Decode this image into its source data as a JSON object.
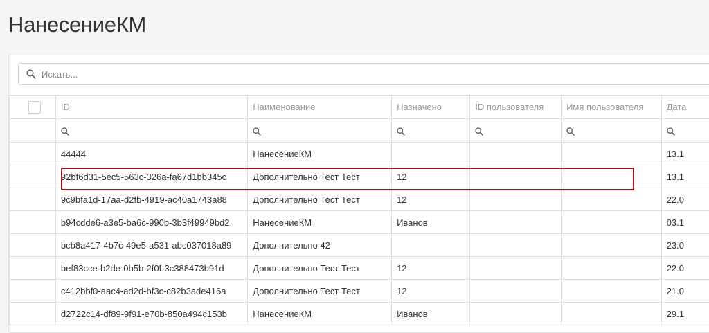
{
  "page_title": "НанесениеКМ",
  "search": {
    "placeholder": "Искать..."
  },
  "columns": [
    "ID",
    "Наименование",
    "Назначено",
    "ID пользователя",
    "Имя пользователя",
    "Дата"
  ],
  "rows": [
    {
      "id": "44444",
      "name": "НанесениеКМ",
      "assigned": "",
      "user_id": "",
      "user_name": "",
      "date": "13.1"
    },
    {
      "id": "92bf6d31-5ec5-563c-326a-fa67d1bb345c",
      "name": "Дополнительно Тест Тест",
      "assigned": "12",
      "user_id": "",
      "user_name": "",
      "date": "13.1"
    },
    {
      "id": "9c9bfa1d-17aa-d2fb-4919-ac40a1743a88",
      "name": "Дополнительно Тест Тест",
      "assigned": "12",
      "user_id": "",
      "user_name": "",
      "date": "22.0"
    },
    {
      "id": "b94cdde6-a3e5-ba6c-990b-3b3f49949bd2",
      "name": "НанесениеКМ",
      "assigned": "Иванов",
      "user_id": "",
      "user_name": "",
      "date": "03.1"
    },
    {
      "id": "bcb8a417-4b7c-49e5-a531-abc037018a89",
      "name": "Дополнительно 42",
      "assigned": "",
      "user_id": "",
      "user_name": "",
      "date": "23.0"
    },
    {
      "id": "bef83cce-b2de-0b5b-2f0f-3c388473b91d",
      "name": "Дополнительно Тест Тест",
      "assigned": "12",
      "user_id": "",
      "user_name": "",
      "date": "22.0"
    },
    {
      "id": "c412bbf0-aac4-ad2d-bf3c-c82b3ade416a",
      "name": "Дополнительно Тест Тест",
      "assigned": "12",
      "user_id": "",
      "user_name": "",
      "date": "21.0"
    },
    {
      "id": "d2722c14-df89-9f91-e70b-850a494c153b",
      "name": "НанесениеКМ",
      "assigned": "Иванов",
      "user_id": "",
      "user_name": "",
      "date": "29.1"
    }
  ],
  "colors": {
    "highlight": "#a4161a",
    "border": "#e0e0e0",
    "header_text": "#999999"
  },
  "icons": {
    "search": "search-icon",
    "filter": "search-icon"
  }
}
